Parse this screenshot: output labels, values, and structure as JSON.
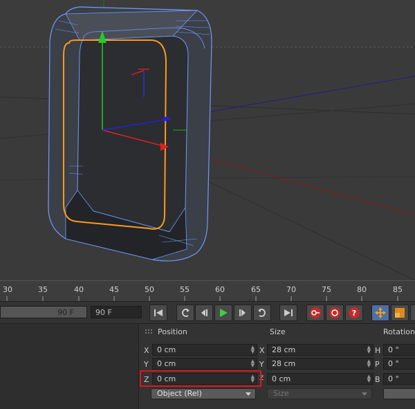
{
  "timeline": {
    "ticks": [
      "30",
      "35",
      "40",
      "45",
      "50",
      "55",
      "60",
      "65",
      "70",
      "75",
      "80",
      "85"
    ]
  },
  "transport": {
    "end_frame_field": "90 F",
    "end_frame_box": "90 F"
  },
  "coords": {
    "position_header": "Position",
    "size_header": "Size",
    "rotation_header": "Rotation",
    "rows": [
      {
        "pos_axis": "X",
        "pos": "0 cm",
        "size_axis": "X",
        "size": "28 cm",
        "rot_axis": "H",
        "rot": "0 °"
      },
      {
        "pos_axis": "Y",
        "pos": "0 cm",
        "size_axis": "Y",
        "size": "28 cm",
        "rot_axis": "P",
        "rot": "0 °"
      },
      {
        "pos_axis": "Z",
        "pos": "0 cm",
        "size_axis": "Z",
        "size": "0 cm",
        "rot_axis": "B",
        "rot": "0 °"
      }
    ],
    "mode_dropdown": "Object (Rel)",
    "size_dropdown": "Size"
  },
  "colors": {
    "highlight_box": "#e0141e",
    "accent_orange": "#ff9a1a",
    "wire_blue": "#6f9bff"
  },
  "icons": [
    "skip-start-icon",
    "prev-key-icon",
    "prev-frame-icon",
    "play-icon",
    "next-frame-icon",
    "next-key-icon",
    "skip-end-icon",
    "record-icon",
    "autokey-icon",
    "help-icon",
    "move-tool-icon",
    "scale-tool-icon"
  ]
}
